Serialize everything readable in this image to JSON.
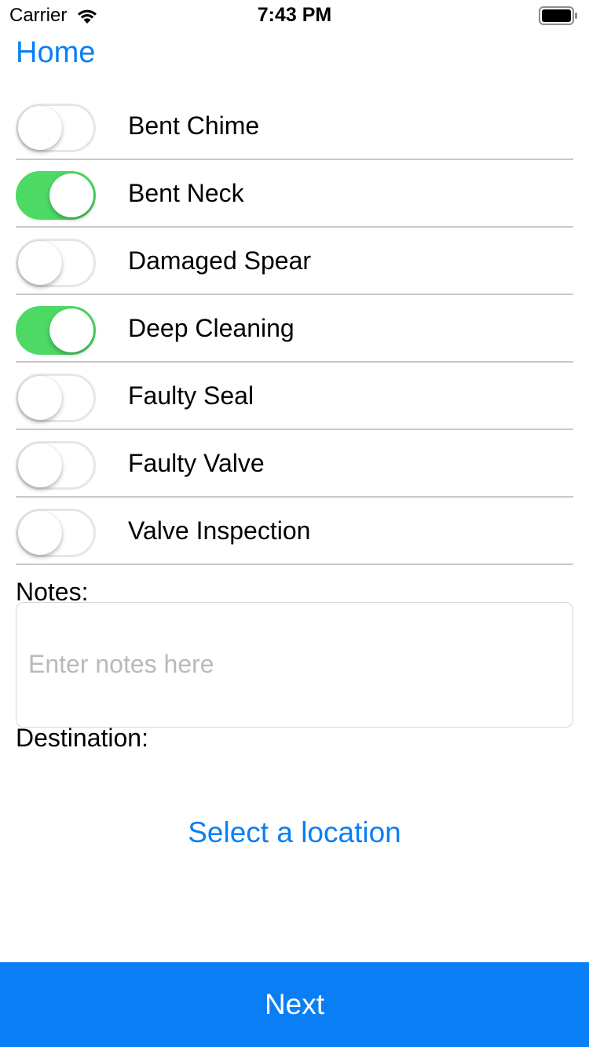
{
  "status_bar": {
    "carrier": "Carrier",
    "time": "7:43 PM",
    "icons": [
      "wifi-icon",
      "battery-icon"
    ]
  },
  "nav": {
    "back_label": "Home"
  },
  "options": [
    {
      "label": "Bent Chime",
      "on": false
    },
    {
      "label": "Bent Neck",
      "on": true
    },
    {
      "label": "Damaged Spear",
      "on": false
    },
    {
      "label": "Deep Cleaning",
      "on": true
    },
    {
      "label": "Faulty Seal",
      "on": false
    },
    {
      "label": "Faulty Valve",
      "on": false
    },
    {
      "label": "Valve Inspection",
      "on": false
    }
  ],
  "notes": {
    "label": "Notes:",
    "value": "",
    "placeholder": "Enter notes here"
  },
  "destination": {
    "label": "Destination:",
    "select_label": "Select a location"
  },
  "footer": {
    "next_label": "Next"
  },
  "colors": {
    "accent": "#0a7ff5",
    "switch_on": "#4cd964",
    "separator": "#c8c7cc",
    "placeholder": "#b9b9be"
  }
}
